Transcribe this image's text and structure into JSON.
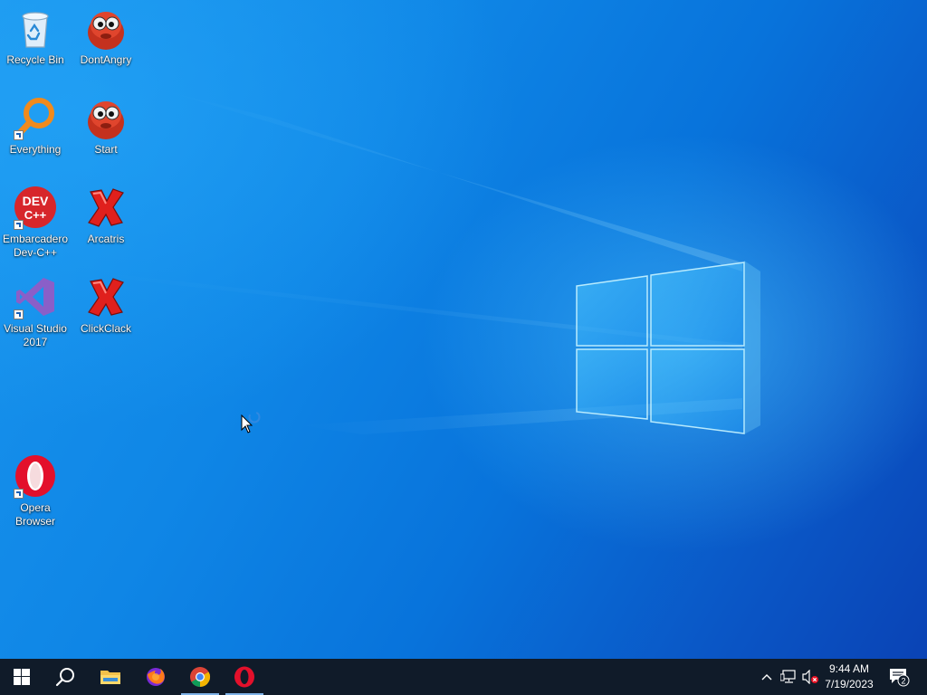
{
  "desktop": {
    "icons": [
      {
        "label": "Recycle Bin",
        "icon": "recycle-bin-icon"
      },
      {
        "label": "DontAngry",
        "icon": "dontangry-icon"
      },
      {
        "label": "Everything",
        "icon": "everything-icon"
      },
      {
        "label": "Start",
        "icon": "start-app-icon"
      },
      {
        "label": "Embarcadero Dev-C++",
        "icon": "devcpp-icon",
        "badge": "DEV C++"
      },
      {
        "label": "Arcatris",
        "icon": "arcatris-icon"
      },
      {
        "label": "Visual Studio 2017",
        "icon": "visual-studio-icon"
      },
      {
        "label": "ClickClack",
        "icon": "clickclack-icon"
      },
      {
        "label": "Opera Browser",
        "icon": "opera-icon"
      }
    ]
  },
  "taskbar": {
    "buttons": [
      {
        "name": "start-button",
        "icon": "windows-logo-icon"
      },
      {
        "name": "search-button",
        "icon": "search-icon"
      },
      {
        "name": "file-explorer-button",
        "icon": "folder-icon"
      },
      {
        "name": "firefox-button",
        "icon": "firefox-icon"
      },
      {
        "name": "chrome-button",
        "icon": "chrome-icon"
      },
      {
        "name": "opera-button",
        "icon": "opera-icon"
      }
    ],
    "running": [
      "chrome-button",
      "opera-button"
    ],
    "tray": {
      "icons": [
        "chevron-up-icon",
        "network-icon",
        "volume-muted-icon"
      ],
      "time": "9:44 AM",
      "date": "7/19/2023",
      "notification_count": "2"
    }
  },
  "colors": {
    "taskbar": "#101b29",
    "desktop_accent": "#0a6fd6"
  }
}
